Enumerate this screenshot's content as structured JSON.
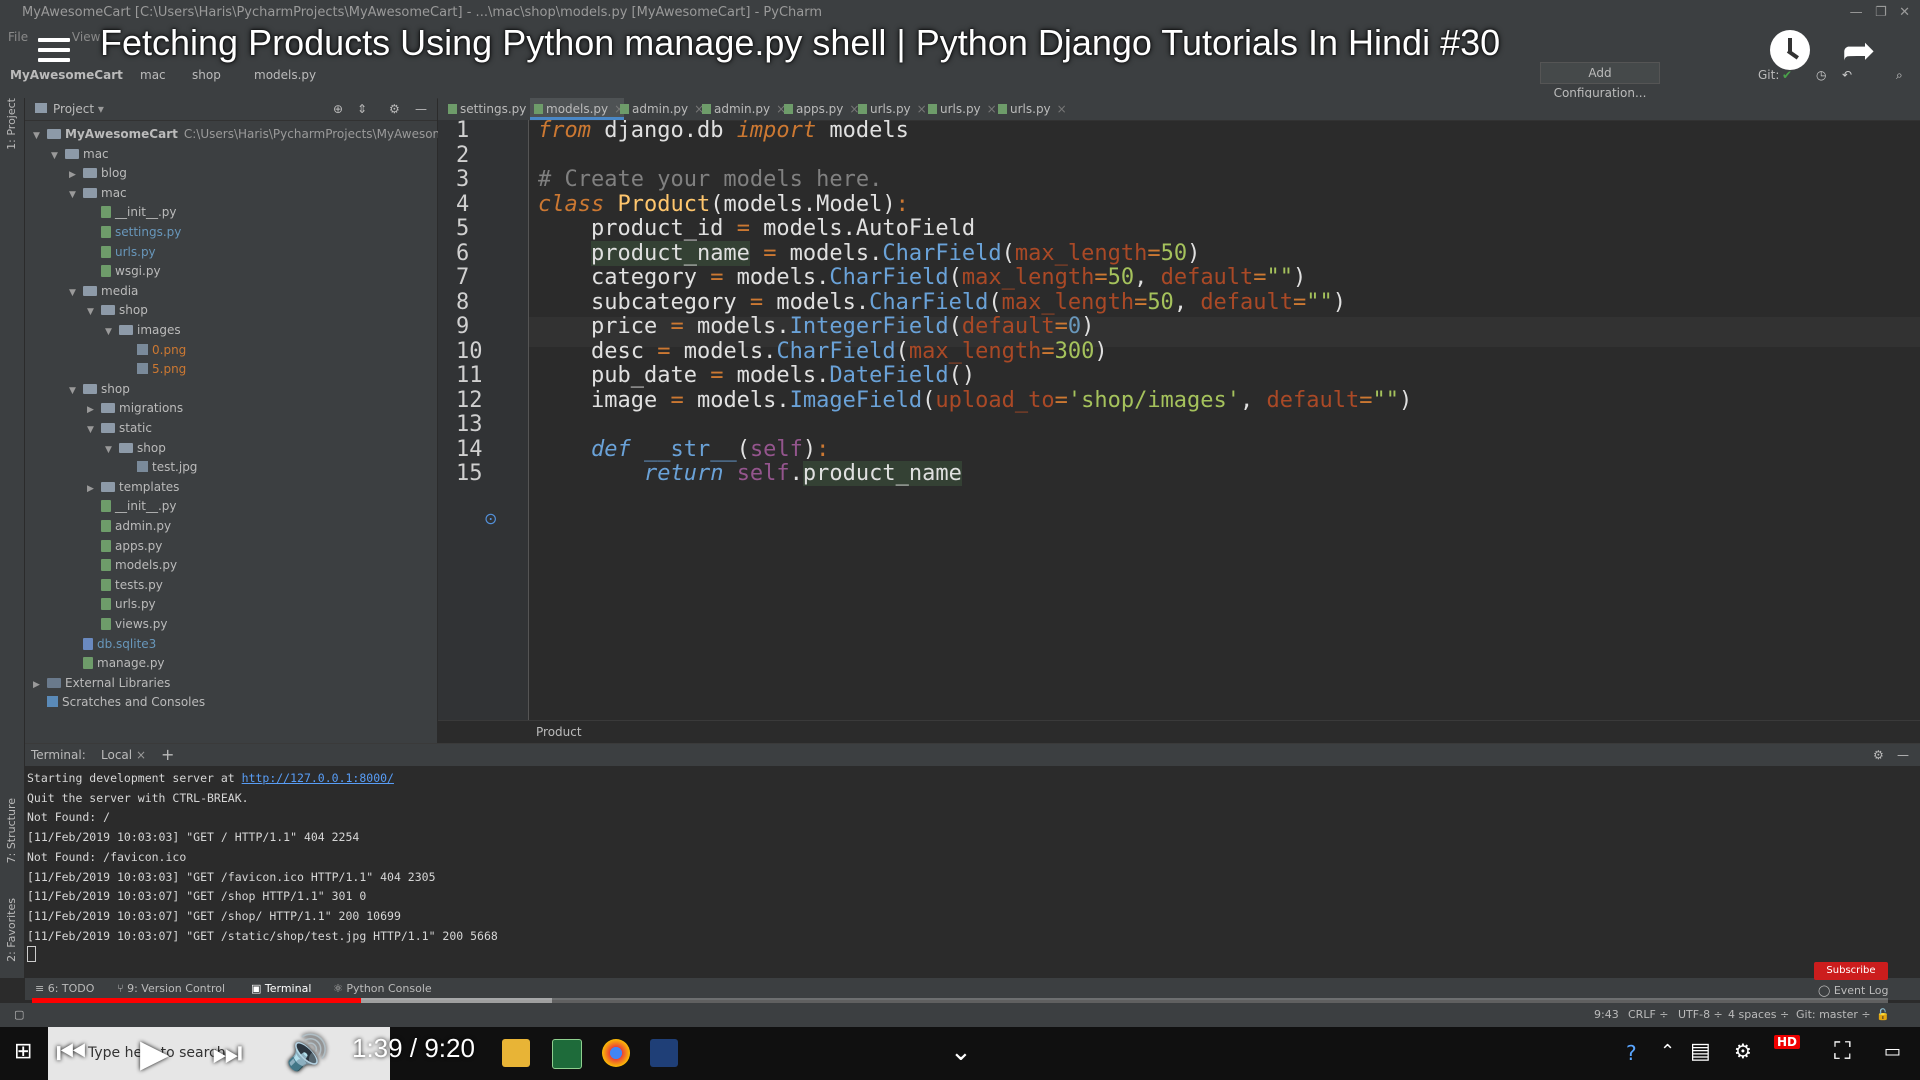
{
  "window": {
    "title": "MyAwesomeCart [C:\\Users\\Haris\\PycharmProjects\\MyAwesomeCart] - ...\\mac\\shop\\models.py [MyAwesomeCart] - PyCharm"
  },
  "menu": {
    "items": [
      "File",
      "View"
    ]
  },
  "breadcrumb": [
    "MyAwesomeCart",
    "mac",
    "shop",
    "models.py"
  ],
  "toolbar": {
    "add_config": "Add Configuration...",
    "git": "Git:"
  },
  "video": {
    "title": "Fetching Products Using Python manage.py shell | Python Django Tutorials In Hindi #30",
    "time_current": "1:39",
    "time_total": "9:20",
    "time_separator": "/",
    "progress": 0.177,
    "buffered": 0.28,
    "hd": "HD",
    "subscribe": "Subscribe"
  },
  "left_strip": {
    "project": "1: Project",
    "structure": "7: Structure",
    "favorites": "2: Favorites"
  },
  "project": {
    "header": "Project",
    "root_path": "C:\\Users\\Haris\\PycharmProjects\\MyAwesomeCart",
    "items": [
      {
        "label": "MyAwesomeCart",
        "indent": 0,
        "kind": "folder",
        "open": true
      },
      {
        "label": "mac",
        "indent": 1,
        "kind": "folder",
        "open": true
      },
      {
        "label": "blog",
        "indent": 2,
        "kind": "folder",
        "open": false
      },
      {
        "label": "mac",
        "indent": 2,
        "kind": "folder",
        "open": true
      },
      {
        "label": "__init__.py",
        "indent": 3,
        "kind": "py"
      },
      {
        "label": "settings.py",
        "indent": 3,
        "kind": "py",
        "color": "blue"
      },
      {
        "label": "urls.py",
        "indent": 3,
        "kind": "py",
        "color": "blue"
      },
      {
        "label": "wsgi.py",
        "indent": 3,
        "kind": "py"
      },
      {
        "label": "media",
        "indent": 2,
        "kind": "folder",
        "open": true
      },
      {
        "label": "shop",
        "indent": 3,
        "kind": "folder",
        "open": true
      },
      {
        "label": "images",
        "indent": 4,
        "kind": "folder",
        "open": true
      },
      {
        "label": "0.png",
        "indent": 5,
        "kind": "img",
        "color": "orange"
      },
      {
        "label": "5.png",
        "indent": 5,
        "kind": "img",
        "color": "orange"
      },
      {
        "label": "shop",
        "indent": 2,
        "kind": "folder",
        "open": true
      },
      {
        "label": "migrations",
        "indent": 3,
        "kind": "folder",
        "open": false
      },
      {
        "label": "static",
        "indent": 3,
        "kind": "folder",
        "open": true
      },
      {
        "label": "shop",
        "indent": 4,
        "kind": "folder",
        "open": true
      },
      {
        "label": "test.jpg",
        "indent": 5,
        "kind": "img"
      },
      {
        "label": "templates",
        "indent": 3,
        "kind": "folder",
        "open": false
      },
      {
        "label": "__init__.py",
        "indent": 3,
        "kind": "py"
      },
      {
        "label": "admin.py",
        "indent": 3,
        "kind": "py"
      },
      {
        "label": "apps.py",
        "indent": 3,
        "kind": "py"
      },
      {
        "label": "models.py",
        "indent": 3,
        "kind": "py"
      },
      {
        "label": "tests.py",
        "indent": 3,
        "kind": "py"
      },
      {
        "label": "urls.py",
        "indent": 3,
        "kind": "py"
      },
      {
        "label": "views.py",
        "indent": 3,
        "kind": "py"
      },
      {
        "label": "db.sqlite3",
        "indent": 2,
        "kind": "db",
        "color": "blue"
      },
      {
        "label": "manage.py",
        "indent": 2,
        "kind": "py"
      },
      {
        "label": "External Libraries",
        "indent": 0,
        "kind": "lib",
        "open": false
      },
      {
        "label": "Scratches and Consoles",
        "indent": 0,
        "kind": "scratch"
      }
    ]
  },
  "tabs": [
    {
      "label": "settings.py",
      "active": false
    },
    {
      "label": "models.py",
      "active": true
    },
    {
      "label": "admin.py",
      "active": false
    },
    {
      "label": "admin.py",
      "active": false
    },
    {
      "label": "apps.py",
      "active": false
    },
    {
      "label": "urls.py",
      "active": false
    },
    {
      "label": "urls.py",
      "active": false
    },
    {
      "label": "urls.py",
      "active": false
    }
  ],
  "editor": {
    "current_line": 9,
    "breadcrumb": "Product",
    "lines": [
      [
        [
          "kw",
          "from"
        ],
        [
          "t",
          " django.db "
        ],
        [
          "kw",
          "import"
        ],
        [
          "t",
          " models"
        ]
      ],
      [],
      [
        [
          "cm",
          "# Create your models here."
        ]
      ],
      [
        [
          "kw",
          "class "
        ],
        [
          "cls",
          "Product"
        ],
        [
          "t",
          "(models.Model)"
        ],
        [
          "kwc",
          ":"
        ]
      ],
      [
        [
          "t",
          "    product_id "
        ],
        [
          "kwc",
          "="
        ],
        [
          "t",
          " models.AutoField"
        ]
      ],
      [
        [
          "t",
          "    "
        ],
        [
          "hl",
          "product_name"
        ],
        [
          "t",
          " "
        ],
        [
          "kwc",
          "="
        ],
        [
          "t",
          " models."
        ],
        [
          "fn",
          "CharField"
        ],
        [
          "t",
          "("
        ],
        [
          "arg",
          "max_length"
        ],
        [
          "kwc",
          "="
        ],
        [
          "num",
          "50"
        ],
        [
          "t",
          ")"
        ]
      ],
      [
        [
          "t",
          "    category "
        ],
        [
          "kwc",
          "="
        ],
        [
          "t",
          " models."
        ],
        [
          "fn",
          "CharField"
        ],
        [
          "t",
          "("
        ],
        [
          "arg",
          "max_length"
        ],
        [
          "kwc",
          "="
        ],
        [
          "num",
          "50"
        ],
        [
          "t",
          ", "
        ],
        [
          "arg",
          "default"
        ],
        [
          "kwc",
          "="
        ],
        [
          "str",
          "\"\""
        ],
        [
          "t",
          ")"
        ]
      ],
      [
        [
          "t",
          "    subcategory "
        ],
        [
          "kwc",
          "="
        ],
        [
          "t",
          " models."
        ],
        [
          "fn",
          "CharField"
        ],
        [
          "t",
          "("
        ],
        [
          "arg",
          "max_length"
        ],
        [
          "kwc",
          "="
        ],
        [
          "num",
          "50"
        ],
        [
          "t",
          ", "
        ],
        [
          "arg",
          "default"
        ],
        [
          "kwc",
          "="
        ],
        [
          "str",
          "\"\""
        ],
        [
          "t",
          ")"
        ]
      ],
      [
        [
          "t",
          "    price "
        ],
        [
          "kwc",
          "="
        ],
        [
          "t",
          " models."
        ],
        [
          "fn",
          "IntegerField"
        ],
        [
          "t",
          "("
        ],
        [
          "arg",
          "default"
        ],
        [
          "kwc",
          "="
        ],
        [
          "numb",
          "0"
        ],
        [
          "t",
          ")"
        ]
      ],
      [
        [
          "t",
          "    desc "
        ],
        [
          "kwc",
          "="
        ],
        [
          "t",
          " models."
        ],
        [
          "fn",
          "CharField"
        ],
        [
          "t",
          "("
        ],
        [
          "arg",
          "max_length"
        ],
        [
          "kwc",
          "="
        ],
        [
          "num",
          "300"
        ],
        [
          "t",
          ")"
        ]
      ],
      [
        [
          "t",
          "    pub_date "
        ],
        [
          "kwc",
          "="
        ],
        [
          "t",
          " models."
        ],
        [
          "fn",
          "DateField"
        ],
        [
          "t",
          "()"
        ]
      ],
      [
        [
          "t",
          "    image "
        ],
        [
          "kwc",
          "="
        ],
        [
          "t",
          " models."
        ],
        [
          "fn",
          "ImageField"
        ],
        [
          "t",
          "("
        ],
        [
          "arg",
          "upload_to"
        ],
        [
          "kwc",
          "="
        ],
        [
          "str",
          "'shop/images'"
        ],
        [
          "t",
          ", "
        ],
        [
          "arg",
          "default"
        ],
        [
          "kwc",
          "="
        ],
        [
          "str",
          "\"\""
        ],
        [
          "t",
          ")"
        ]
      ],
      [],
      [
        [
          "t",
          "    "
        ],
        [
          "kwi",
          "def "
        ],
        [
          "fn",
          "__str__"
        ],
        [
          "t",
          "("
        ],
        [
          "slf",
          "self"
        ],
        [
          "t",
          ")"
        ],
        [
          "kwc",
          ":"
        ]
      ],
      [
        [
          "t",
          "        "
        ],
        [
          "kwi",
          "return "
        ],
        [
          "slf",
          "self"
        ],
        [
          "t",
          "."
        ],
        [
          "hl",
          "product_name"
        ]
      ]
    ]
  },
  "terminal": {
    "label": "Terminal:",
    "tab": "Local",
    "lines": [
      {
        "text": "Starting development server at ",
        "link": "http://127.0.0.1:8000/"
      },
      {
        "text": "Quit the server with CTRL-BREAK."
      },
      {
        "text": "Not Found: /"
      },
      {
        "text": "[11/Feb/2019 10:03:03] \"GET / HTTP/1.1\" 404 2254"
      },
      {
        "text": "Not Found: /favicon.ico"
      },
      {
        "text": "[11/Feb/2019 10:03:03] \"GET /favicon.ico HTTP/1.1\" 404 2305"
      },
      {
        "text": "[11/Feb/2019 10:03:07] \"GET /shop HTTP/1.1\" 301 0"
      },
      {
        "text": "[11/Feb/2019 10:03:07] \"GET /shop/ HTTP/1.1\" 200 10699"
      },
      {
        "text": "[11/Feb/2019 10:03:07] \"GET /static/shop/test.jpg HTTP/1.1\" 200 5668"
      }
    ]
  },
  "bottom_tools": [
    "6: TODO",
    "9: Version Control",
    "Terminal",
    "Python Console"
  ],
  "event_log": "Event Log",
  "status": {
    "position": "9:43",
    "line_sep": "CRLF ÷",
    "encoding": "UTF-8 ÷",
    "indent": "4 spaces ÷",
    "git": "Git: master ÷"
  },
  "taskbar": {
    "search_placeholder": "Type here to search"
  }
}
